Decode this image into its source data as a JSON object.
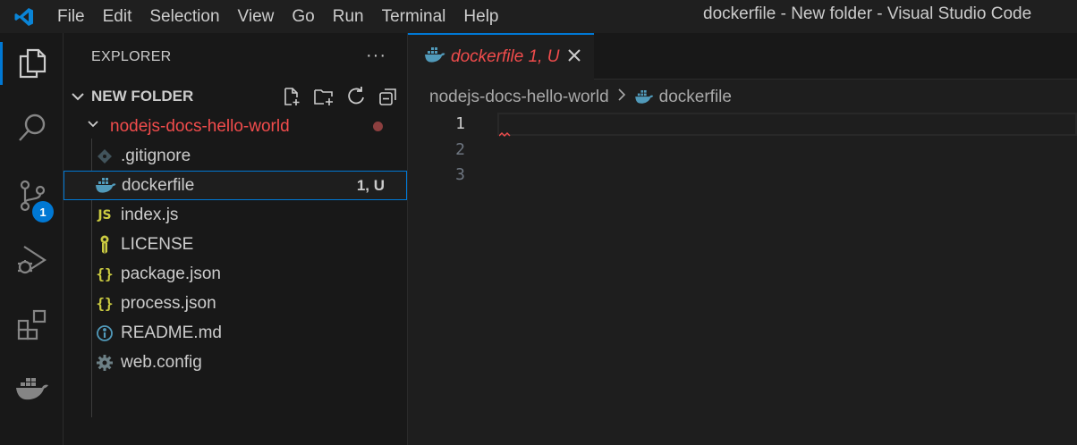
{
  "titlebar": {
    "menu": [
      "File",
      "Edit",
      "Selection",
      "View",
      "Go",
      "Run",
      "Terminal",
      "Help"
    ],
    "title": "dockerfile - New folder - Visual Studio Code"
  },
  "activitybar": {
    "items": [
      "explorer-icon",
      "search-icon",
      "source-control-icon",
      "run-debug-icon",
      "extensions-icon",
      "docker-icon"
    ],
    "source_control_badge": "1"
  },
  "sidebar": {
    "title": "EXPLORER",
    "folder_name": "NEW FOLDER",
    "subfolder": "nodejs-docs-hello-world",
    "files": [
      {
        "name": ".gitignore",
        "icon": "git-icon",
        "status": ""
      },
      {
        "name": "dockerfile",
        "icon": "docker-icon",
        "status": "1, U"
      },
      {
        "name": "index.js",
        "icon": "js-icon",
        "status": ""
      },
      {
        "name": "LICENSE",
        "icon": "license-icon",
        "status": ""
      },
      {
        "name": "package.json",
        "icon": "json-icon",
        "status": ""
      },
      {
        "name": "process.json",
        "icon": "json-icon",
        "status": ""
      },
      {
        "name": "README.md",
        "icon": "info-icon",
        "status": ""
      },
      {
        "name": "web.config",
        "icon": "gear-icon",
        "status": ""
      }
    ]
  },
  "editor": {
    "tab_label": "dockerfile 1, U",
    "breadcrumb": [
      "nodejs-docs-hello-world",
      "dockerfile"
    ],
    "line_numbers": [
      "1",
      "2",
      "3"
    ]
  },
  "colors": {
    "accent": "#0078d4",
    "error": "#f14c4c",
    "docker": "#519aba",
    "json": "#cbcb41"
  }
}
